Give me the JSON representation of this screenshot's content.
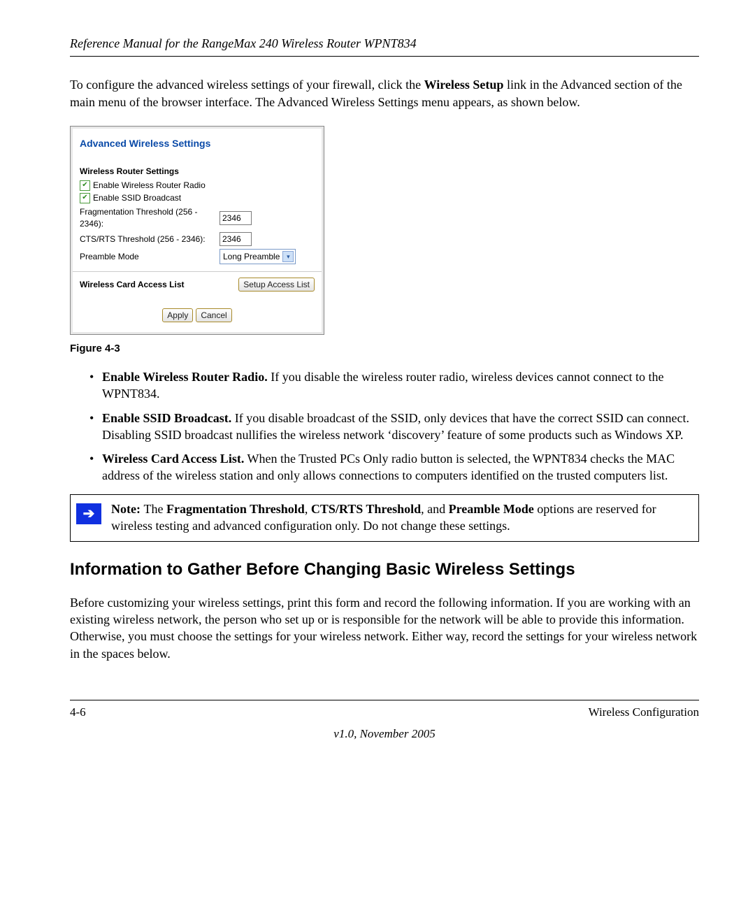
{
  "header": "Reference Manual for the RangeMax 240 Wireless Router WPNT834",
  "intro": {
    "pre": "To configure the advanced wireless settings of your firewall, click the ",
    "bold": "Wireless Setup",
    "post": " link in the Advanced section of the main menu of the browser interface. The Advanced Wireless Settings menu appears, as shown below."
  },
  "panel": {
    "title": "Advanced Wireless Settings",
    "section1": "Wireless Router Settings",
    "cb1": "Enable Wireless Router Radio",
    "cb2": "Enable SSID Broadcast",
    "frag_label": "Fragmentation Threshold (256 - 2346):",
    "frag_value": "2346",
    "cts_label": "CTS/RTS Threshold (256 - 2346):",
    "cts_value": "2346",
    "preamble_label": "Preamble Mode",
    "preamble_value": "Long Preamble",
    "access_label": "Wireless Card Access List",
    "access_button": "Setup Access List",
    "apply": "Apply",
    "cancel": "Cancel"
  },
  "figure_caption": "Figure 4-3",
  "bullets": [
    {
      "bold": "Enable Wireless Router Radio.",
      "text": " If you disable the wireless router radio, wireless devices cannot connect to the WPNT834."
    },
    {
      "bold": "Enable SSID Broadcast.",
      "text": " If you disable broadcast of the SSID, only devices that have the correct SSID can connect. Disabling SSID broadcast nullifies the wireless network ‘discovery’ feature of some products such as Windows XP."
    },
    {
      "bold": "Wireless Card Access List.",
      "text": " When the Trusted PCs Only radio button is selected, the WPNT834 checks the MAC address of the wireless station and only allows connections to computers identified on the trusted computers list."
    }
  ],
  "note": {
    "lead": "Note: ",
    "mid1": "The ",
    "b1": "Fragmentation Threshold",
    "c1": ", ",
    "b2": "CTS/RTS Threshold",
    "c2": ", and ",
    "b3": "Preamble Mode",
    "tail": " options are reserved for wireless testing and advanced configuration only. Do not change these settings."
  },
  "section_heading": "Information to Gather Before Changing Basic Wireless Settings",
  "section_para": "Before customizing your wireless settings, print this form and record the following information. If you are working with an existing wireless network, the person who set up or is responsible for the network will be able to provide this information. Otherwise, you must choose the settings for your wireless network. Either way, record the settings for your wireless network in the spaces below.",
  "footer": {
    "left": "4-6",
    "right": "Wireless Configuration",
    "center": "v1.0, November 2005"
  }
}
